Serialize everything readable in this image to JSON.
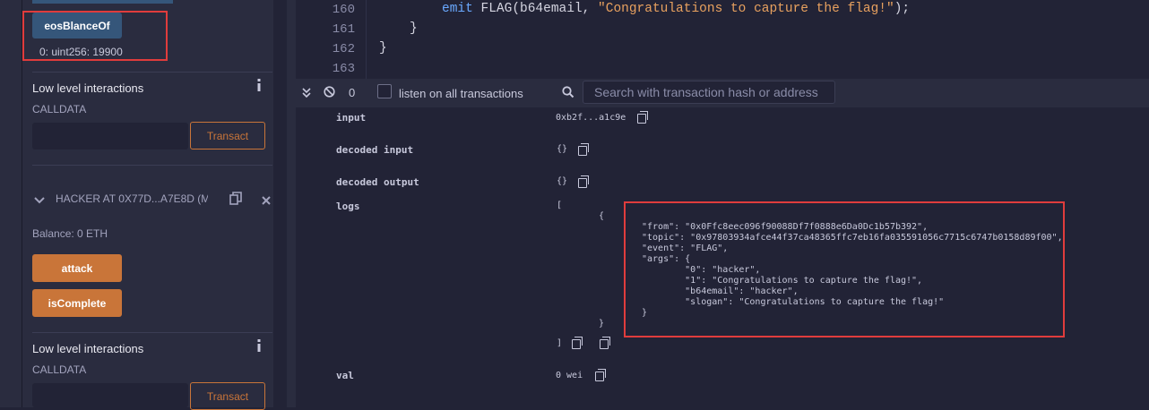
{
  "contract1": {
    "function_button": "eosBlanceOf",
    "result": "0: uint256: 19900",
    "low_level_title": "Low level interactions",
    "calldata_label": "CALLDATA",
    "transact_label": "Transact"
  },
  "contract2": {
    "title": "HACKER AT 0X77D...A7E8D (M",
    "balance": "Balance: 0 ETH",
    "attack_label": "attack",
    "is_complete_label": "isComplete",
    "low_level_title": "Low level interactions",
    "calldata_label": "CALLDATA",
    "transact_label": "Transact"
  },
  "editor": {
    "lines": [
      {
        "num": "160",
        "kw": "emit",
        "fn": " FLAG(b64email, ",
        "str": "\"Congratulations to capture the flag!\"",
        "tail": ");"
      },
      {
        "num": "161",
        "text": "}"
      },
      {
        "num": "162",
        "text": "}"
      },
      {
        "num": "163",
        "text": ""
      }
    ]
  },
  "terminal": {
    "count": "0",
    "listen_label": "listen on all transactions",
    "search_placeholder": "Search with transaction hash or address"
  },
  "tx": {
    "input_key": "input",
    "input_val": "0xb2f...a1c9e",
    "decoded_input_key": "decoded input",
    "decoded_input_val": "{}",
    "decoded_output_key": "decoded output",
    "decoded_output_val": "{}",
    "logs_key": "logs",
    "logs_open": "[",
    "logs_close": "]",
    "log_brace_open": "{",
    "log_brace_close": "}",
    "log_lines": [
      "\"from\": \"0x0Ffc8eec096f90088Df7f0888e6Da0Dc1b57b392\",",
      "\"topic\": \"0x97803934afce44f37ca48365ffc7eb16fa035591056c7715c6747b0158d89f00\",",
      "\"event\": \"FLAG\",",
      "\"args\": {",
      "        \"0\": \"hacker\",",
      "        \"1\": \"Congratulations to capture the flag!\",",
      "        \"b64email\": \"hacker\",",
      "        \"slogan\": \"Congratulations to capture the flag!\"",
      "}"
    ],
    "val_key": "val",
    "val_val": "0 wei"
  }
}
